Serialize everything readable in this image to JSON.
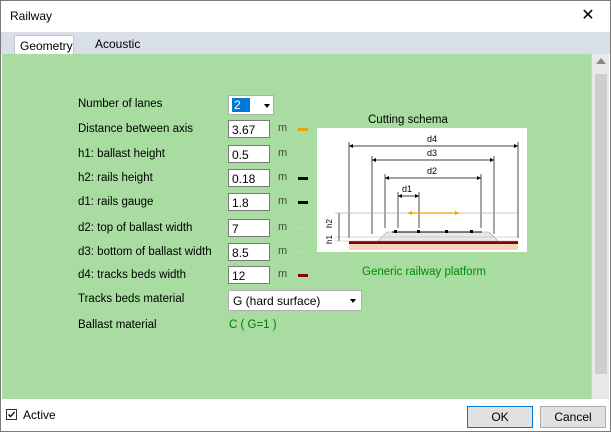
{
  "window": {
    "title": "Railway"
  },
  "tabs": [
    {
      "label": "Geometry",
      "active": true
    },
    {
      "label": "Acoustic",
      "active": false
    }
  ],
  "form": {
    "lanes_label": "Number of lanes",
    "lanes_value": "2",
    "fields": [
      {
        "label": "Distance between axis",
        "value": "3.67",
        "unit": "m",
        "color": "#f0a000"
      },
      {
        "label": "h1: ballast height",
        "value": "0.5",
        "unit": "m",
        "color": "#b8d8b0"
      },
      {
        "label": "h2: rails height",
        "value": "0.18",
        "unit": "m",
        "color": "#000000"
      },
      {
        "label": "d1: rails gauge",
        "value": "1.8",
        "unit": "m",
        "color": "#000000"
      },
      {
        "label": "d2: top of ballast width",
        "value": "7",
        "unit": "m",
        "color": "#b8d8b0"
      },
      {
        "label": "d3: bottom of ballast width",
        "value": "8.5",
        "unit": "m",
        "color": "#b8d8b0"
      },
      {
        "label": "d4: tracks beds width",
        "value": "12",
        "unit": "m",
        "color": "#8b0000"
      }
    ],
    "material_label": "Tracks beds material",
    "material_value": "G (hard surface)",
    "ballast_label": "Ballast material",
    "ballast_value": "C  ( G=1 )"
  },
  "schema": {
    "title": "Cutting schema",
    "caption": "Generic railway platform",
    "dims": [
      "d4",
      "d3",
      "d2",
      "d1",
      "h2",
      "h1"
    ]
  },
  "footer": {
    "active_label": "Active",
    "active_checked": true,
    "ok_label": "OK",
    "cancel_label": "Cancel"
  }
}
